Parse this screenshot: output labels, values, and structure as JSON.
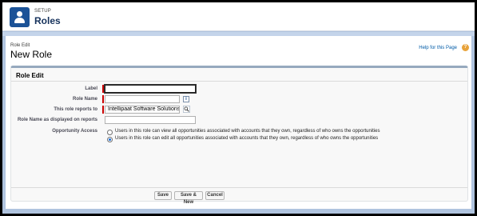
{
  "header": {
    "section_label": "SETUP",
    "title": "Roles"
  },
  "page": {
    "breadcrumb": "Role Edit",
    "title": "New Role",
    "help_link": "Help for this Page",
    "help_icon": "?"
  },
  "form": {
    "section_title": "Role Edit",
    "fields": {
      "label": {
        "label": "Label",
        "value": ""
      },
      "role_name": {
        "label": "Role Name",
        "value": "",
        "info_icon": "i"
      },
      "reports_to": {
        "label": "This role reports to",
        "value": "Intellipaat Software Solutions"
      },
      "display_name": {
        "label": "Role Name as displayed on reports",
        "value": ""
      }
    },
    "opportunity_access": {
      "label": "Opportunity Access",
      "options": [
        {
          "text": "Users in this role can view all opportunities associated with accounts that they own, regardless of who owns the opportunities",
          "selected": false
        },
        {
          "text": "Users in this role can edit all opportunities associated with accounts that they own, regardless of who owns the opportunities",
          "selected": true
        }
      ]
    }
  },
  "buttons": {
    "save": "Save",
    "save_new": "Save & New",
    "cancel": "Cancel"
  },
  "colors": {
    "brand": "#1b5297",
    "required": "#cc0000",
    "link": "#015ba7",
    "help": "#e8a33b"
  }
}
